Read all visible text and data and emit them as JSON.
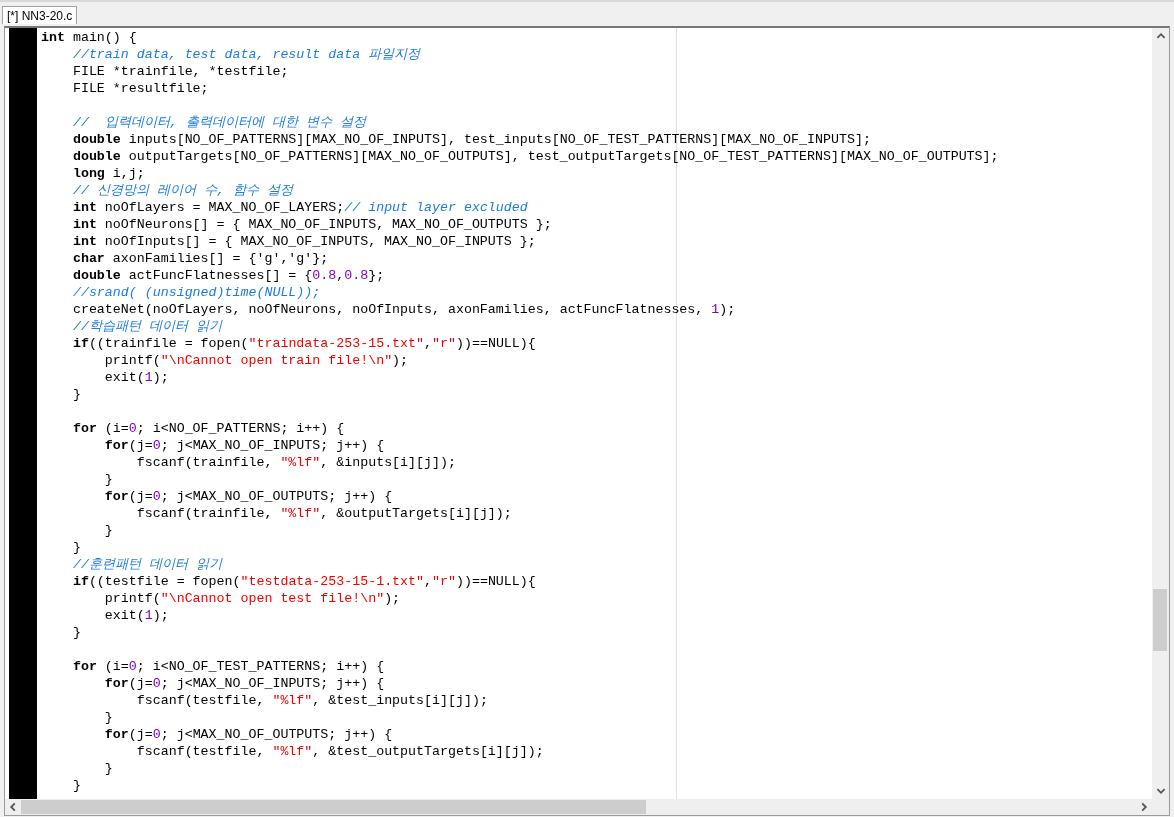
{
  "tabs": [
    {
      "label": "[*] NN3-20.c",
      "selected": true
    }
  ],
  "editor": {
    "lines": [
      {
        "kind": "code",
        "tokens": [
          {
            "kind": "kw",
            "text": "int"
          },
          {
            "kind": "tx",
            "text": " main() {"
          }
        ]
      },
      {
        "kind": "code",
        "tokens": [
          {
            "kind": "cm",
            "text": "    //train data, test data, result data 파일지정"
          }
        ]
      },
      {
        "kind": "code",
        "tokens": [
          {
            "kind": "tx",
            "text": "    FILE *trainfile, *testfile;"
          }
        ]
      },
      {
        "kind": "code",
        "tokens": [
          {
            "kind": "tx",
            "text": "    FILE *resultfile;"
          }
        ]
      },
      {
        "kind": "blank"
      },
      {
        "kind": "code",
        "tokens": [
          {
            "kind": "cm",
            "text": "    //  입력데이터, 출력데이터에 대한 변수 설정"
          }
        ]
      },
      {
        "kind": "code",
        "tokens": [
          {
            "kind": "kw",
            "text": "    double"
          },
          {
            "kind": "tx",
            "text": " inputs[NO_OF_PATTERNS][MAX_NO_OF_INPUTS], test_inputs[NO_OF_TEST_PATTERNS][MAX_NO_OF_INPUTS];"
          }
        ]
      },
      {
        "kind": "code",
        "tokens": [
          {
            "kind": "kw",
            "text": "    double"
          },
          {
            "kind": "tx",
            "text": " outputTargets[NO_OF_PATTERNS][MAX_NO_OF_OUTPUTS], test_outputTargets[NO_OF_TEST_PATTERNS][MAX_NO_OF_OUTPUTS];"
          }
        ]
      },
      {
        "kind": "code",
        "tokens": [
          {
            "kind": "kw",
            "text": "    long"
          },
          {
            "kind": "tx",
            "text": " i,j;"
          }
        ]
      },
      {
        "kind": "code",
        "tokens": [
          {
            "kind": "cm",
            "text": "    // 신경망의 레이어 수, 함수 설정"
          }
        ]
      },
      {
        "kind": "code",
        "tokens": [
          {
            "kind": "kw",
            "text": "    int"
          },
          {
            "kind": "tx",
            "text": " noOfLayers = MAX_NO_OF_LAYERS;"
          },
          {
            "kind": "cm",
            "text": "// input layer excluded"
          }
        ]
      },
      {
        "kind": "code",
        "tokens": [
          {
            "kind": "kw",
            "text": "    int"
          },
          {
            "kind": "tx",
            "text": " noOfNeurons[] = { MAX_NO_OF_INPUTS, MAX_NO_OF_OUTPUTS };"
          }
        ]
      },
      {
        "kind": "code",
        "tokens": [
          {
            "kind": "kw",
            "text": "    int"
          },
          {
            "kind": "tx",
            "text": " noOfInputs[] = { MAX_NO_OF_INPUTS, MAX_NO_OF_INPUTS };"
          }
        ]
      },
      {
        "kind": "code",
        "tokens": [
          {
            "kind": "kw",
            "text": "    char"
          },
          {
            "kind": "tx",
            "text": " axonFamilies[] = {'g','g'};"
          }
        ]
      },
      {
        "kind": "code",
        "tokens": [
          {
            "kind": "kw",
            "text": "    double"
          },
          {
            "kind": "tx",
            "text": " actFuncFlatnesses[] = {"
          },
          {
            "kind": "nm",
            "text": "0.8"
          },
          {
            "kind": "tx",
            "text": ","
          },
          {
            "kind": "nm",
            "text": "0.8"
          },
          {
            "kind": "tx",
            "text": "};"
          }
        ]
      },
      {
        "kind": "code",
        "tokens": [
          {
            "kind": "cm",
            "text": "    //srand( (unsigned)time(NULL));"
          }
        ]
      },
      {
        "kind": "code",
        "tokens": [
          {
            "kind": "tx",
            "text": "    createNet(noOfLayers, noOfNeurons, noOfInputs, axonFamilies, actFuncFlatnesses, "
          },
          {
            "kind": "nm",
            "text": "1"
          },
          {
            "kind": "tx",
            "text": ");"
          }
        ]
      },
      {
        "kind": "code",
        "tokens": [
          {
            "kind": "cm",
            "text": "    //학습패턴 데이터 읽기"
          }
        ]
      },
      {
        "kind": "code",
        "tokens": [
          {
            "kind": "kw",
            "text": "    if"
          },
          {
            "kind": "tx",
            "text": "((trainfile = fopen("
          },
          {
            "kind": "st",
            "text": "\"traindata-253-15.txt\""
          },
          {
            "kind": "tx",
            "text": ","
          },
          {
            "kind": "st",
            "text": "\"r\""
          },
          {
            "kind": "tx",
            "text": "))==NULL){"
          }
        ]
      },
      {
        "kind": "code",
        "tokens": [
          {
            "kind": "tx",
            "text": "        printf("
          },
          {
            "kind": "st",
            "text": "\"\\nCannot open train file!\\n\""
          },
          {
            "kind": "tx",
            "text": ");"
          }
        ]
      },
      {
        "kind": "code",
        "tokens": [
          {
            "kind": "tx",
            "text": "        exit("
          },
          {
            "kind": "nm",
            "text": "1"
          },
          {
            "kind": "tx",
            "text": ");"
          }
        ]
      },
      {
        "kind": "code",
        "tokens": [
          {
            "kind": "tx",
            "text": "    }"
          }
        ]
      },
      {
        "kind": "blank"
      },
      {
        "kind": "code",
        "tokens": [
          {
            "kind": "kw",
            "text": "    for"
          },
          {
            "kind": "tx",
            "text": " (i="
          },
          {
            "kind": "nm",
            "text": "0"
          },
          {
            "kind": "tx",
            "text": "; i<NO_OF_PATTERNS; i++) {"
          }
        ]
      },
      {
        "kind": "code",
        "tokens": [
          {
            "kind": "kw",
            "text": "        for"
          },
          {
            "kind": "tx",
            "text": "(j="
          },
          {
            "kind": "nm",
            "text": "0"
          },
          {
            "kind": "tx",
            "text": "; j<MAX_NO_OF_INPUTS; j++) {"
          }
        ]
      },
      {
        "kind": "code",
        "tokens": [
          {
            "kind": "tx",
            "text": "            fscanf(trainfile, "
          },
          {
            "kind": "st",
            "text": "\"%lf\""
          },
          {
            "kind": "tx",
            "text": ", &inputs[i][j]);"
          }
        ]
      },
      {
        "kind": "code",
        "tokens": [
          {
            "kind": "tx",
            "text": "        }"
          }
        ]
      },
      {
        "kind": "code",
        "tokens": [
          {
            "kind": "kw",
            "text": "        for"
          },
          {
            "kind": "tx",
            "text": "(j="
          },
          {
            "kind": "nm",
            "text": "0"
          },
          {
            "kind": "tx",
            "text": "; j<MAX_NO_OF_OUTPUTS; j++) {"
          }
        ]
      },
      {
        "kind": "code",
        "tokens": [
          {
            "kind": "tx",
            "text": "            fscanf(trainfile, "
          },
          {
            "kind": "st",
            "text": "\"%lf\""
          },
          {
            "kind": "tx",
            "text": ", &outputTargets[i][j]);"
          }
        ]
      },
      {
        "kind": "code",
        "tokens": [
          {
            "kind": "tx",
            "text": "        }"
          }
        ]
      },
      {
        "kind": "code",
        "tokens": [
          {
            "kind": "tx",
            "text": "    }"
          }
        ]
      },
      {
        "kind": "code",
        "tokens": [
          {
            "kind": "cm",
            "text": "    //훈련패턴 데이터 읽기"
          }
        ]
      },
      {
        "kind": "code",
        "tokens": [
          {
            "kind": "kw",
            "text": "    if"
          },
          {
            "kind": "tx",
            "text": "((testfile = fopen("
          },
          {
            "kind": "st",
            "text": "\"testdata-253-15-1.txt\""
          },
          {
            "kind": "tx",
            "text": ","
          },
          {
            "kind": "st",
            "text": "\"r\""
          },
          {
            "kind": "tx",
            "text": "))==NULL){"
          }
        ]
      },
      {
        "kind": "code",
        "tokens": [
          {
            "kind": "tx",
            "text": "        printf("
          },
          {
            "kind": "st",
            "text": "\"\\nCannot open test file!\\n\""
          },
          {
            "kind": "tx",
            "text": ");"
          }
        ]
      },
      {
        "kind": "code",
        "tokens": [
          {
            "kind": "tx",
            "text": "        exit("
          },
          {
            "kind": "nm",
            "text": "1"
          },
          {
            "kind": "tx",
            "text": ");"
          }
        ]
      },
      {
        "kind": "code",
        "tokens": [
          {
            "kind": "tx",
            "text": "    }"
          }
        ]
      },
      {
        "kind": "blank"
      },
      {
        "kind": "code",
        "tokens": [
          {
            "kind": "kw",
            "text": "    for"
          },
          {
            "kind": "tx",
            "text": " (i="
          },
          {
            "kind": "nm",
            "text": "0"
          },
          {
            "kind": "tx",
            "text": "; i<NO_OF_TEST_PATTERNS; i++) {"
          }
        ]
      },
      {
        "kind": "code",
        "tokens": [
          {
            "kind": "kw",
            "text": "        for"
          },
          {
            "kind": "tx",
            "text": "(j="
          },
          {
            "kind": "nm",
            "text": "0"
          },
          {
            "kind": "tx",
            "text": "; j<MAX_NO_OF_INPUTS; j++) {"
          }
        ]
      },
      {
        "kind": "code",
        "tokens": [
          {
            "kind": "tx",
            "text": "            fscanf(testfile, "
          },
          {
            "kind": "st",
            "text": "\"%lf\""
          },
          {
            "kind": "tx",
            "text": ", &test_inputs[i][j]);"
          }
        ]
      },
      {
        "kind": "code",
        "tokens": [
          {
            "kind": "tx",
            "text": "        }"
          }
        ]
      },
      {
        "kind": "code",
        "tokens": [
          {
            "kind": "kw",
            "text": "        for"
          },
          {
            "kind": "tx",
            "text": "(j="
          },
          {
            "kind": "nm",
            "text": "0"
          },
          {
            "kind": "tx",
            "text": "; j<MAX_NO_OF_OUTPUTS; j++) {"
          }
        ]
      },
      {
        "kind": "code",
        "tokens": [
          {
            "kind": "tx",
            "text": "            fscanf(testfile, "
          },
          {
            "kind": "st",
            "text": "\"%lf\""
          },
          {
            "kind": "tx",
            "text": ", &test_outputTargets[i][j]);"
          }
        ]
      },
      {
        "kind": "code",
        "tokens": [
          {
            "kind": "tx",
            "text": "        }"
          }
        ]
      },
      {
        "kind": "code",
        "tokens": [
          {
            "kind": "tx",
            "text": "    }"
          }
        ]
      }
    ]
  }
}
